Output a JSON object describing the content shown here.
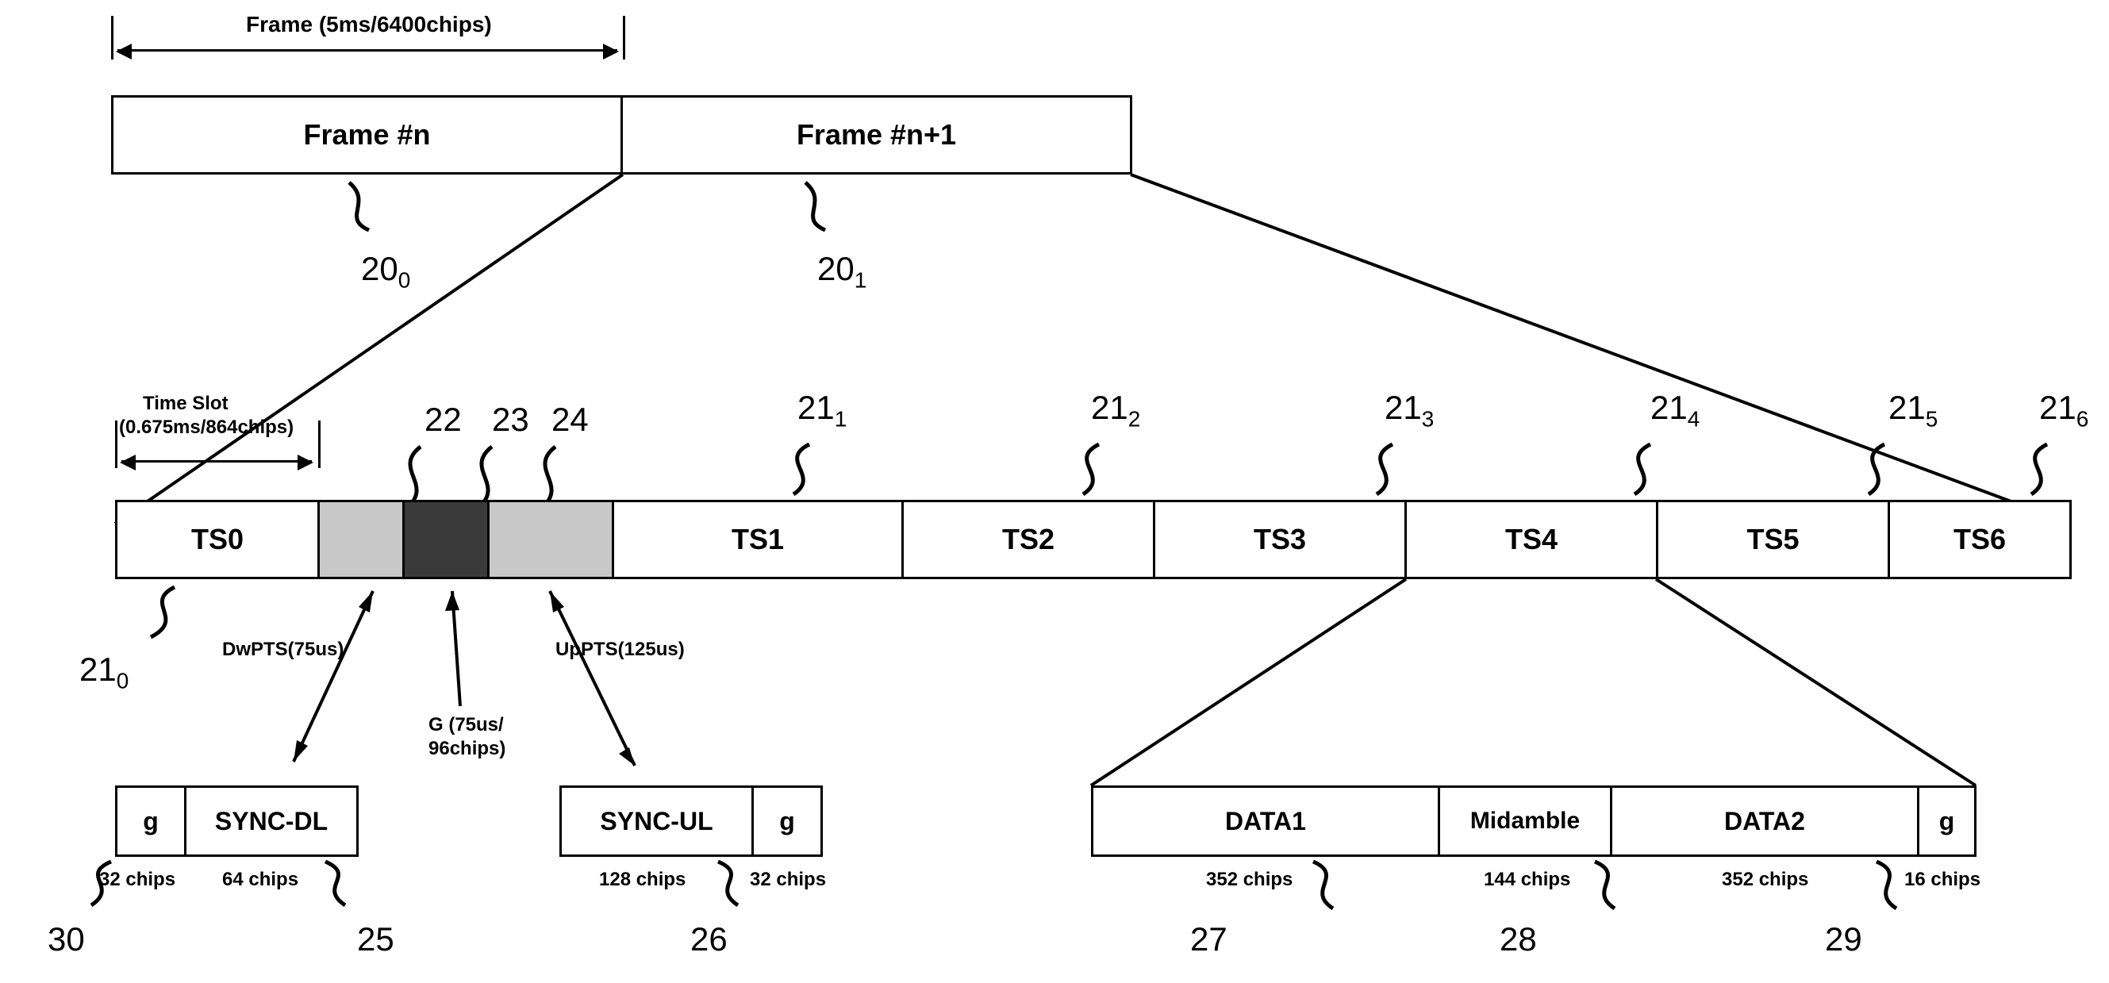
{
  "dim_top": {
    "label": "Frame (5ms/6400chips)"
  },
  "frames": {
    "n": "Frame #n",
    "n1": "Frame #n+1"
  },
  "frame_refs": {
    "r0": "20",
    "r1": "20"
  },
  "dim_slot": {
    "line1": "Time Slot",
    "line2": "(0.675ms/864chips)"
  },
  "slots": {
    "s0": "TS0",
    "s1": "TS1",
    "s2": "TS2",
    "s3": "TS3",
    "s4": "TS4",
    "s5": "TS5",
    "s6": "TS6"
  },
  "slot_refs": {
    "r0": "21",
    "r1": "21",
    "r2": "21",
    "r3": "21",
    "r4": "21",
    "r5": "21",
    "r6": "21"
  },
  "mid_refs": {
    "r22": "22",
    "r23": "23",
    "r24": "24"
  },
  "mid_labels": {
    "dw": "DwPTS(75us)",
    "g1": "G (75us/",
    "g2": "96chips)",
    "up": "UpPTS(125us)"
  },
  "syncdl": {
    "g": "g",
    "label": "SYNC-DL",
    "chips_g": "32 chips",
    "chips_s": "64 chips",
    "ref_g": "30",
    "ref_s": "25"
  },
  "syncul": {
    "label": "SYNC-UL",
    "g": "g",
    "chips_s": "128 chips",
    "chips_g": "32 chips",
    "ref": "26"
  },
  "burst": {
    "d1": "DATA1",
    "mid": "Midamble",
    "d2": "DATA2",
    "g": "g",
    "chips_d1": "352 chips",
    "chips_mid": "144 chips",
    "chips_d2": "352 chips",
    "chips_g": "16 chips",
    "ref_d1": "27",
    "ref_mid": "28",
    "ref_d2": "29"
  }
}
